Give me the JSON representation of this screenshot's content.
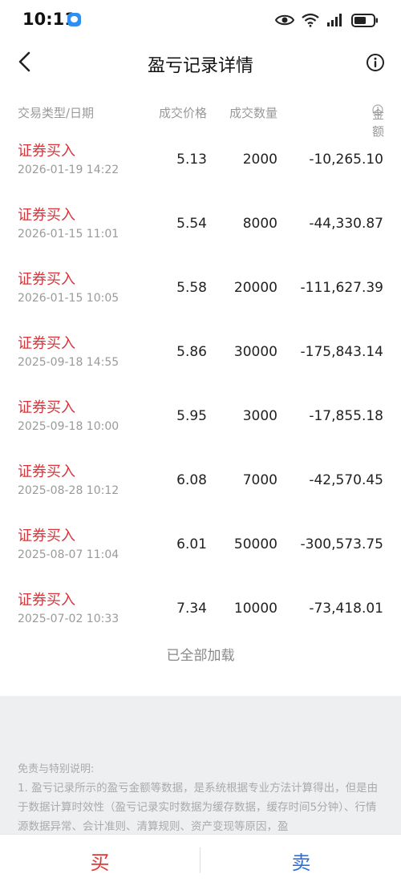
{
  "status_bar": {
    "time": "10:11"
  },
  "nav": {
    "title": "盈亏记录详情"
  },
  "columns": {
    "type_date": "交易类型/日期",
    "price": "成交价格",
    "quantity": "成交数量",
    "amount": "金额"
  },
  "records": [
    {
      "type": "证券买入",
      "date": "2026-01-19 14:22",
      "price": "5.13",
      "quantity": "2000",
      "amount": "-10,265.10"
    },
    {
      "type": "证券买入",
      "date": "2026-01-15 11:01",
      "price": "5.54",
      "quantity": "8000",
      "amount": "-44,330.87"
    },
    {
      "type": "证券买入",
      "date": "2026-01-15 10:05",
      "price": "5.58",
      "quantity": "20000",
      "amount": "-111,627.39"
    },
    {
      "type": "证券买入",
      "date": "2025-09-18 14:55",
      "price": "5.86",
      "quantity": "30000",
      "amount": "-175,843.14"
    },
    {
      "type": "证券买入",
      "date": "2025-09-18 10:00",
      "price": "5.95",
      "quantity": "3000",
      "amount": "-17,855.18"
    },
    {
      "type": "证券买入",
      "date": "2025-08-28 10:12",
      "price": "6.08",
      "quantity": "7000",
      "amount": "-42,570.45"
    },
    {
      "type": "证券买入",
      "date": "2025-08-07 11:04",
      "price": "6.01",
      "quantity": "50000",
      "amount": "-300,573.75"
    },
    {
      "type": "证券买入",
      "date": "2025-07-02 10:33",
      "price": "7.34",
      "quantity": "10000",
      "amount": "-73,418.01"
    }
  ],
  "list_footer": "已全部加载",
  "disclaimer": {
    "title": "免责与特别说明:",
    "text": "1. 盈亏记录所示的盈亏金额等数据，是系统根据专业方法计算得出，但是由于数据计算时效性（盈亏记录实时数据为缓存数据，缓存时间5分钟）、行情源数据异常、会计准则、清算规则、资产变现等原因，盈"
  },
  "bottom_bar": {
    "buy": "买",
    "sell": "卖"
  },
  "colors": {
    "buy": "#e03a36",
    "sell": "#2f6fdc",
    "record_type": "#d6363a",
    "muted": "#999999"
  },
  "icons": {
    "back": "back-arrow-icon",
    "info": "info-circle-icon",
    "notification": "app-notification-icon",
    "eye": "eye-icon",
    "wifi": "wifi-icon",
    "signal": "signal-icon",
    "battery": "battery-icon"
  }
}
